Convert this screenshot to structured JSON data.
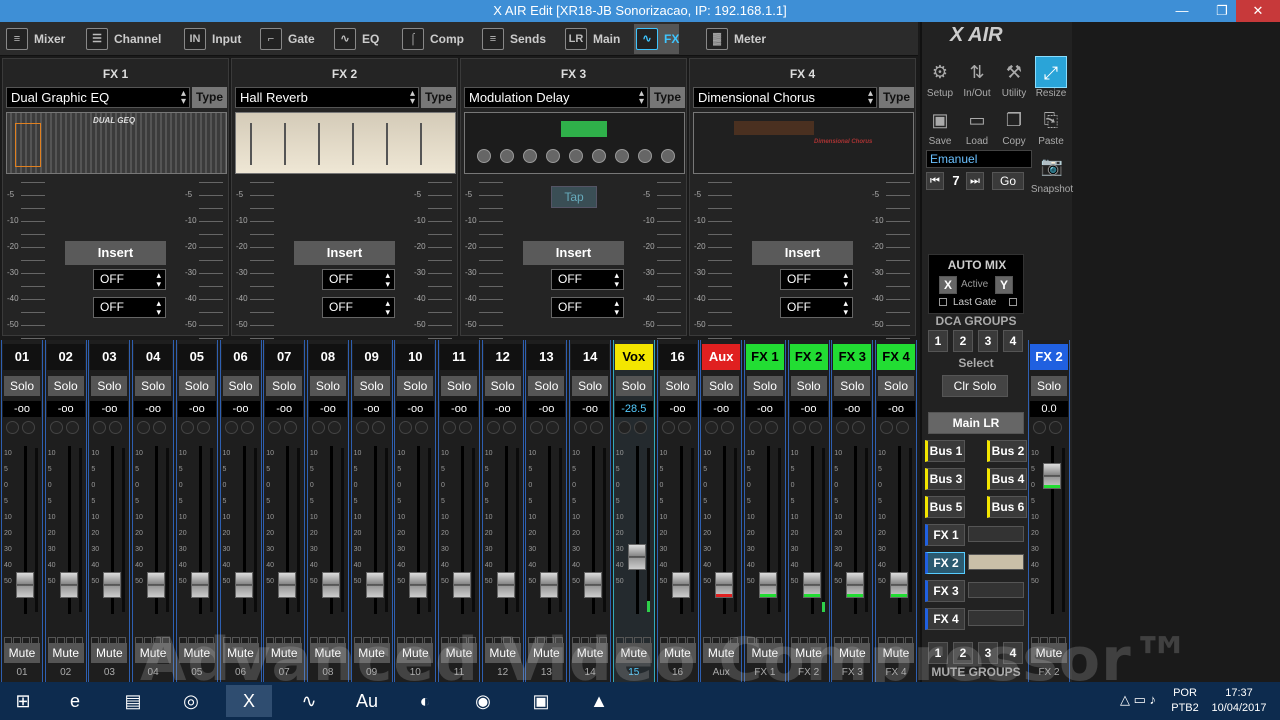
{
  "window": {
    "title": "X AIR Edit [XR18-JB Sonorizacao, IP: 192.168.1.1]",
    "min": "—",
    "max": "❐",
    "close": "✕"
  },
  "tabs": [
    {
      "label": "Mixer",
      "icon": "mixer-icon"
    },
    {
      "label": "Channel",
      "icon": "channel-icon"
    },
    {
      "label": "Input",
      "icon": "input-icon"
    },
    {
      "label": "Gate",
      "icon": "gate-icon"
    },
    {
      "label": "EQ",
      "icon": "eq-icon"
    },
    {
      "label": "Comp",
      "icon": "comp-icon"
    },
    {
      "label": "Sends",
      "icon": "sends-icon"
    },
    {
      "label": "Main",
      "icon": "main-icon"
    },
    {
      "label": "FX",
      "icon": "fx-icon"
    },
    {
      "label": "Meter",
      "icon": "meter-icon"
    }
  ],
  "fx": [
    {
      "header": "FX 1",
      "effect": "Dual Graphic EQ",
      "type": "Type",
      "insert": "Insert",
      "off1": "OFF",
      "off2": "OFF",
      "thumb_label": "DUAL GEQ"
    },
    {
      "header": "FX 2",
      "effect": "Hall Reverb",
      "type": "Type",
      "insert": "Insert",
      "off1": "OFF",
      "off2": "OFF"
    },
    {
      "header": "FX 3",
      "effect": "Modulation Delay",
      "type": "Type",
      "insert": "Insert",
      "off1": "OFF",
      "off2": "OFF",
      "tap": "Tap"
    },
    {
      "header": "FX 4",
      "effect": "Dimensional Chorus",
      "type": "Type",
      "insert": "Insert",
      "off1": "OFF",
      "off2": "OFF",
      "thumb_label": "Dimensional Chorus"
    }
  ],
  "fx_scale": [
    "-5",
    "-10",
    "-20",
    "-30",
    "-40",
    "-50"
  ],
  "fader_scale": [
    "10",
    "5",
    "0",
    "5",
    "10",
    "20",
    "30",
    "40",
    "50"
  ],
  "channels": [
    {
      "label": "01",
      "db": "-oo",
      "name": "01",
      "level": 0.17
    },
    {
      "label": "02",
      "db": "-oo",
      "name": "02",
      "level": 0.17
    },
    {
      "label": "03",
      "db": "-oo",
      "name": "03",
      "level": 0.17
    },
    {
      "label": "04",
      "db": "-oo",
      "name": "04",
      "level": 0.17
    },
    {
      "label": "05",
      "db": "-oo",
      "name": "05",
      "level": 0.17
    },
    {
      "label": "06",
      "db": "-oo",
      "name": "06",
      "level": 0.17
    },
    {
      "label": "07",
      "db": "-oo",
      "name": "07",
      "level": 0.17
    },
    {
      "label": "08",
      "db": "-oo",
      "name": "08",
      "level": 0.17
    },
    {
      "label": "09",
      "db": "-oo",
      "name": "09",
      "level": 0.17
    },
    {
      "label": "10",
      "db": "-oo",
      "name": "10",
      "level": 0.17
    },
    {
      "label": "11",
      "db": "-oo",
      "name": "11",
      "level": 0.17
    },
    {
      "label": "12",
      "db": "-oo",
      "name": "12",
      "level": 0.17
    },
    {
      "label": "13",
      "db": "-oo",
      "name": "13",
      "level": 0.17
    },
    {
      "label": "14",
      "db": "-oo",
      "name": "14",
      "level": 0.17
    },
    {
      "label": "Vox",
      "db": "-28.5",
      "name": "15",
      "level": 0.34,
      "meter": 0.07
    },
    {
      "label": "16",
      "db": "-oo",
      "name": "16",
      "level": 0.17
    },
    {
      "label": "Aux",
      "db": "-oo",
      "name": "Aux",
      "level": 0.17
    },
    {
      "label": "FX 1",
      "db": "-oo",
      "name": "FX 1",
      "level": 0.17
    },
    {
      "label": "FX 2",
      "db": "-oo",
      "name": "FX 2",
      "level": 0.17,
      "meter": 0.06
    },
    {
      "label": "FX 3",
      "db": "-oo",
      "name": "FX 3",
      "level": 0.17
    },
    {
      "label": "FX 4",
      "db": "-oo",
      "name": "FX 4",
      "level": 0.17
    }
  ],
  "channel_colors": {
    "Vox": "#f3e600",
    "Aux": "#e02020",
    "FX": "#22dd33",
    "default": "#111111"
  },
  "strip_buttons": {
    "solo": "Solo",
    "mute": "Mute"
  },
  "right": {
    "logo": "X AIR",
    "toolbar": [
      {
        "label": "Setup",
        "icon": "gear-icon"
      },
      {
        "label": "In/Out",
        "icon": "inout-icon"
      },
      {
        "label": "Utility",
        "icon": "wrench-icon"
      },
      {
        "label": "Resize",
        "icon": "resize-icon"
      },
      {
        "label": "Save",
        "icon": "save-icon"
      },
      {
        "label": "Load",
        "icon": "folder-icon"
      },
      {
        "label": "Copy",
        "icon": "copy-icon"
      },
      {
        "label": "Paste",
        "icon": "paste-icon"
      }
    ],
    "scene_name": "Emanuel",
    "scene_number": "7",
    "go": "Go",
    "snapshot": "Snapshot",
    "automix": {
      "title": "AUTO MIX",
      "x": "X",
      "active": "Active",
      "y": "Y",
      "lastgate": "Last Gate"
    },
    "dca": {
      "title": "DCA GROUPS",
      "buttons": [
        "1",
        "2",
        "3",
        "4"
      ],
      "select": "Select",
      "clrsolo": "Clr Solo"
    },
    "mainlr": "Main LR",
    "buses": [
      "Bus 1",
      "Bus 2",
      "Bus 3",
      "Bus 4",
      "Bus 5",
      "Bus 6"
    ],
    "fxsends": [
      "FX 1",
      "FX 2",
      "FX 3",
      "FX 4"
    ],
    "mute_groups": {
      "title": "MUTE GROUPS",
      "buttons": [
        "1",
        "2",
        "3",
        "4"
      ]
    }
  },
  "fx2_master": {
    "label": "FX 2",
    "solo": "Solo",
    "db": "0.0",
    "mute": "Mute",
    "name": "FX 2",
    "level": 0.82
  },
  "taskbar": {
    "lang": "POR",
    "layout": "PTB2",
    "time": "17:37",
    "date": "10/04/2017",
    "apps": [
      "windows-start-icon",
      "ie-icon",
      "explorer-icon",
      "chrome-icon",
      "xair-icon",
      "meter-app-icon",
      "audition-icon",
      "protools-icon",
      "spotify-icon",
      "remote-icon",
      "vlc-icon"
    ]
  },
  "watermark": "Advanced Video Compressor™"
}
